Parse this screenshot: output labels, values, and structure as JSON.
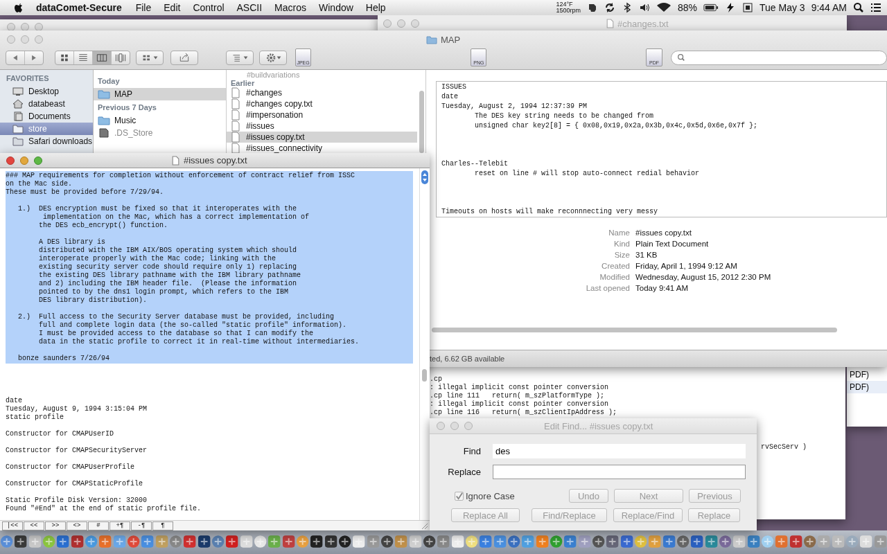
{
  "menu_bar": {
    "app": "dataComet-Secure",
    "menus": [
      "File",
      "Edit",
      "Control",
      "ASCII",
      "Macros",
      "Window",
      "Help"
    ],
    "temperature": "124°F",
    "fan_speed": "1500rpm",
    "battery": "88%",
    "date": "Tue May 3",
    "time": "9:44 AM"
  },
  "background_window": {
    "title": "#changes.txt"
  },
  "finder": {
    "title": "MAP",
    "file_icons": [
      "JPEG",
      "PNG",
      "PDF"
    ],
    "sidebar": {
      "heading": "FAVORITES",
      "items": [
        {
          "label": "Desktop",
          "kind": "desktop",
          "selected": false
        },
        {
          "label": "databeast",
          "kind": "home",
          "selected": false
        },
        {
          "label": "Documents",
          "kind": "documents",
          "selected": false
        },
        {
          "label": "store",
          "kind": "folder",
          "selected": true
        },
        {
          "label": "Safari downloads",
          "kind": "folder",
          "selected": false
        }
      ]
    },
    "column_1": {
      "sections": [
        {
          "heading": "Today",
          "items": [
            {
              "label": "MAP",
              "kind": "folder",
              "selected": true
            }
          ]
        },
        {
          "heading": "Previous 7 Days",
          "items": [
            {
              "label": "Music",
              "kind": "folder",
              "selected": false
            },
            {
              "label": ".DS_Store",
              "kind": "file",
              "selected": false
            }
          ]
        }
      ]
    },
    "column_2": {
      "drag_ghost": "#buildvariations",
      "heading": "Earlier",
      "items": [
        {
          "label": "#changes",
          "selected": false
        },
        {
          "label": "#changes copy.txt",
          "selected": false
        },
        {
          "label": "#impersonation",
          "selected": false
        },
        {
          "label": "#issues",
          "selected": false
        },
        {
          "label": "#issues copy.txt",
          "selected": true
        },
        {
          "label": "#issues_connectivity",
          "selected": false
        }
      ]
    },
    "preview": [
      "ISSUES\ndate\nTuesday, August 2, 1994 12:37:39 PM\n        The DES key string needs to be changed from\n        unsigned char key2[8] = { 0x08,0x19,0x2a,0x3b,0x4c,0x5d,0x6e,0x7f };",
      "Charles--Telebit\n        reset on line # will stop auto-connect redial behavior",
      "Timeouts on hosts will make reconnnecting very messy"
    ],
    "info": [
      {
        "label": "Name",
        "value": "#issues copy.txt"
      },
      {
        "label": "Kind",
        "value": "Plain Text Document"
      },
      {
        "label": "Size",
        "value": "31 KB"
      },
      {
        "label": "Created",
        "value": "Friday, April 1, 1994 9:12 AM"
      },
      {
        "label": "Modified",
        "value": "Wednesday, August 15, 2012 2:30 PM"
      },
      {
        "label": "Last opened",
        "value": "Today 9:41 AM"
      }
    ],
    "status": "ted, 6.62 GB available"
  },
  "build_log": {
    "lines": [
      ".cp",
      ": illegal implicit const pointer conversion",
      ".cp line 111   return( m_szPlatformType );",
      ": illegal implicit const pointer conversion",
      ".cp line 116   return( m_szClientIpAddress );"
    ],
    "fragment": "rvSecServ )"
  },
  "side_list": {
    "rows": [
      {
        "label": "PDF)",
        "selected": false
      },
      {
        "label": "PDF)",
        "selected": true
      }
    ]
  },
  "editor": {
    "title": "#issues copy.txt",
    "blocks": [
      {
        "selected": true,
        "paragraphs": [
          "### MAP requirements for completion without enforcement of contract relief from ISSC\non the Mac side.\nThese must be provided before 7/29/94.",
          "   1.)  DES encryption must be fixed so that it interoperates with the\n         implementation on the Mac, which has a correct implementation of\n        the DES ecb_encrypt() function.",
          "        A DES library is\n        distributed with the IBM AIX/BOS operating system which should\n        interoperate properly with the Mac code; linking with the\n        existing security server code should require only 1) replacing\n        the existing DES library pathname with the IBM library pathname\n        and 2) including the IBM header file.  (Please the information\n        pointed to by the dns1 login prompt, which refers to the IBM\n        DES library distribution).",
          "   2.)  Full access to the Security Server database must be provided, including\n        full and complete login data (the so-called \"static profile\" information).\n        I must be provided access to the database so that I can modify the\n        data in the static profile to correct it in real-time without intermediaries.",
          "   bonze saunders 7/26/94"
        ]
      },
      {
        "selected": false,
        "paragraphs": [
          "date\nTuesday, August 9, 1994 3:15:04 PM\nstatic profile",
          "Constructor for CMAPUserID",
          "Constructor for CMAPSecurityServer",
          "Constructor for CMAPUserProfile",
          "Constructor for CMAPStaticProfile",
          "Static Profile Disk Version: 32000\nFound \"#End\" at the end of static profile file."
        ]
      }
    ],
    "nav_buttons": [
      "|<<",
      "<<",
      ">>",
      "<>",
      "#",
      "+¶",
      "-¶",
      "¶"
    ]
  },
  "find_dialog": {
    "title": "Edit Find... #issues copy.txt",
    "find_label": "Find",
    "find_value": "des",
    "replace_label": "Replace",
    "ignore_case": {
      "label": "Ignore Case",
      "checked": true
    },
    "buttons_row_1": [
      {
        "label": "Undo",
        "disabled": true
      },
      {
        "label": "Next",
        "disabled": true
      },
      {
        "label": "Previous",
        "disabled": true
      }
    ],
    "buttons_row_2": [
      {
        "label": "Replace All",
        "disabled": true
      },
      {
        "label": "Find/Replace",
        "disabled": true
      },
      {
        "label": "Replace/Find",
        "disabled": true
      },
      {
        "label": "Replace",
        "disabled": true
      }
    ]
  }
}
